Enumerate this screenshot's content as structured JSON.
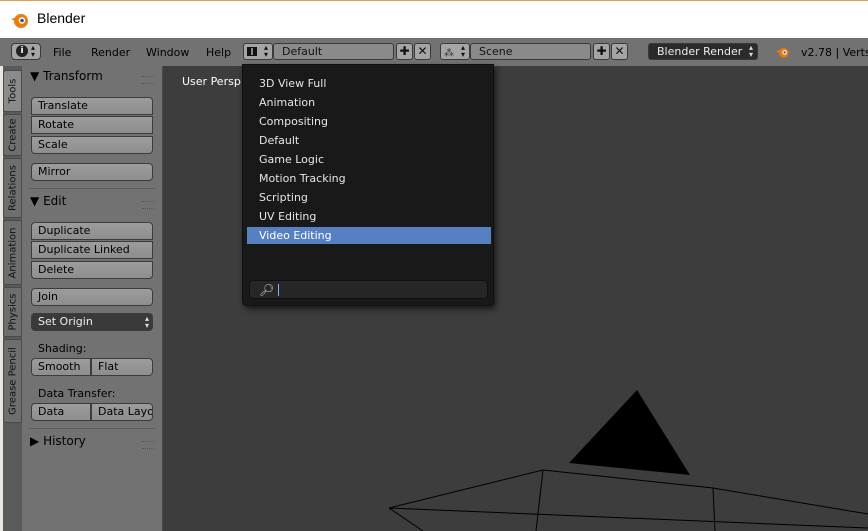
{
  "window": {
    "title": "Blender"
  },
  "infobar": {
    "menus": [
      "File",
      "Render",
      "Window",
      "Help"
    ],
    "screen_layout": "Default",
    "scene": "Scene",
    "render_engine": "Blender Render",
    "version_stats": "v2.78 | Verts"
  },
  "toolshelf": {
    "tabs": [
      "Tools",
      "Create",
      "Relations",
      "Animation",
      "Physics",
      "Grease Pencil"
    ],
    "transform": {
      "header": "Transform",
      "translate": "Translate",
      "rotate": "Rotate",
      "scale": "Scale",
      "mirror": "Mirror"
    },
    "edit": {
      "header": "Edit",
      "duplicate": "Duplicate",
      "duplicate_linked": "Duplicate Linked",
      "delete": "Delete",
      "join": "Join",
      "set_origin": "Set Origin",
      "shading_label": "Shading:",
      "smooth": "Smooth",
      "flat": "Flat",
      "data_transfer_label": "Data Transfer:",
      "data": "Data",
      "data_layout": "Data Layo"
    },
    "history": {
      "header": "History"
    }
  },
  "viewport": {
    "label": "User Persp"
  },
  "layout_dropdown": {
    "items": [
      "3D View Full",
      "Animation",
      "Compositing",
      "Default",
      "Game Logic",
      "Motion Tracking",
      "Scripting",
      "UV Editing",
      "Video Editing"
    ],
    "selected": "Video Editing",
    "search_value": ""
  },
  "colors": {
    "highlight": "#5680c2",
    "viewport_bg": "#3d3d3d",
    "panel_bg": "#727272"
  }
}
